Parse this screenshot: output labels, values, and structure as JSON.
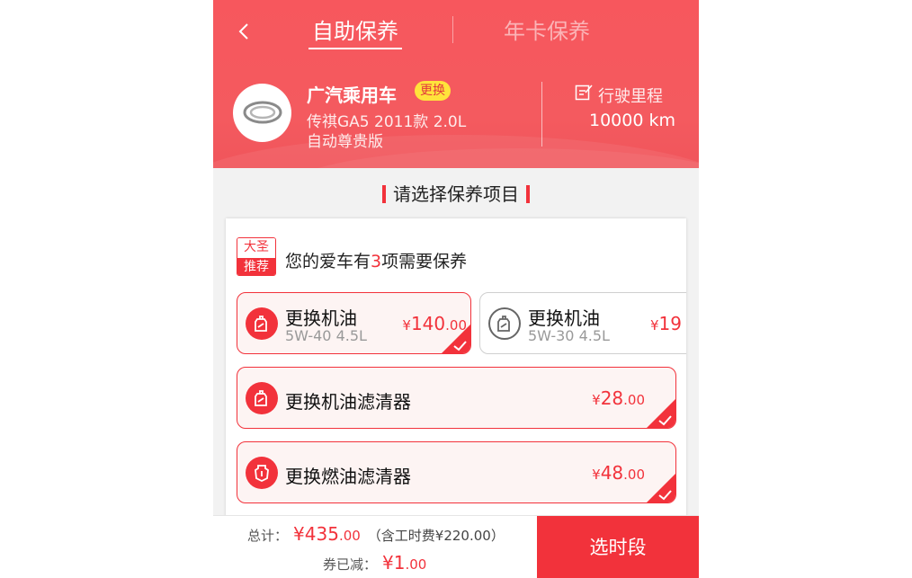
{
  "header": {
    "tabs": [
      {
        "label": "自助保养",
        "active": true
      },
      {
        "label": "年卡保养",
        "active": false
      }
    ],
    "car": {
      "brand": "广汽乘用车",
      "change_label": "更换",
      "model_line1": "传祺GA5 2011款 2.0L",
      "model_line2": "自动尊贵版"
    },
    "mileage": {
      "label": "行驶里程",
      "value": "10000 km"
    }
  },
  "section_title": "请选择保养项目",
  "recommend": {
    "badge_top": "大圣",
    "badge_bottom": "推荐",
    "text_before": "您的爱车有",
    "count": "3",
    "text_after": "项需要保养"
  },
  "items": [
    {
      "name": "更换机油",
      "spec": "5W-40 4.5L",
      "price_int": "140",
      "price_dec": ".00",
      "selected": true,
      "icon": "oil-can-icon"
    },
    {
      "name": "更换机油",
      "spec": "5W-30 4.5L",
      "price_int": "19",
      "price_dec": "",
      "selected": false,
      "icon": "oil-can-icon"
    },
    {
      "name": "更换机油滤清器",
      "spec": "",
      "price_int": "28",
      "price_dec": ".00",
      "selected": true,
      "icon": "oil-filter-icon"
    },
    {
      "name": "更换燃油滤清器",
      "spec": "",
      "price_int": "48",
      "price_dec": ".00",
      "selected": true,
      "icon": "fuel-filter-icon"
    }
  ],
  "currency": "¥",
  "footer": {
    "total_label": "总计：",
    "total_int": "435",
    "total_dec": ".00",
    "labor_text": "（含工时费¥220.00）",
    "coupon_label": "券已减：",
    "coupon_int": "1",
    "coupon_dec": ".00",
    "select_button": "选时段"
  },
  "colors": {
    "accent": "#f2323b",
    "header": "#f5565c",
    "badge_yellow": "#ffe33b"
  }
}
